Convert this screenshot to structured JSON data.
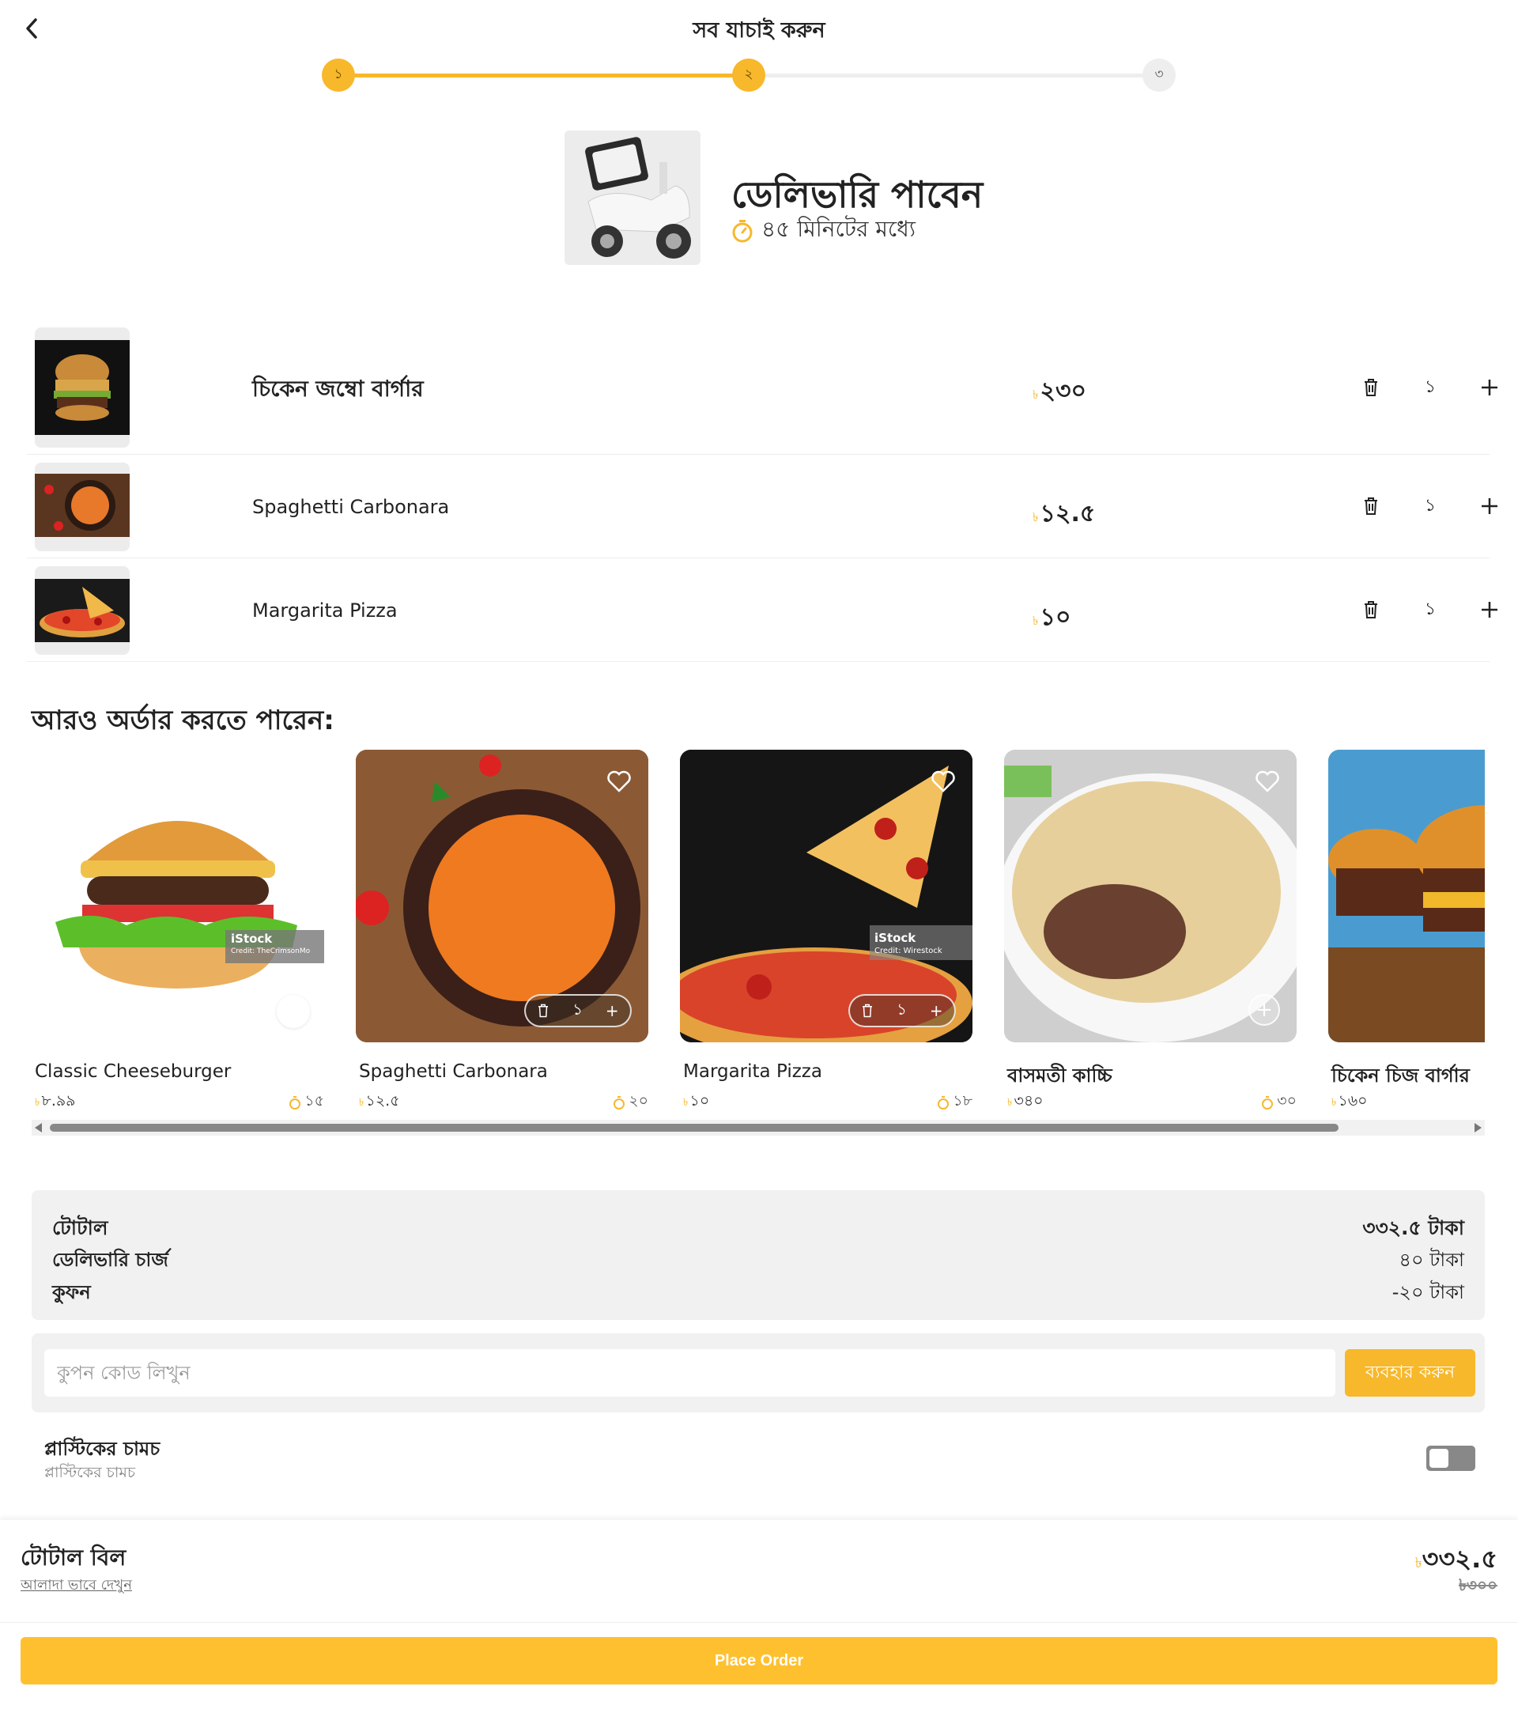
{
  "header": {
    "title": "সব যাচাই করুন"
  },
  "stepper": {
    "steps": [
      "১",
      "২",
      "৩"
    ],
    "current_step": 2
  },
  "delivery": {
    "title": "ডেলিভারি পাবেন",
    "time": "৪৫ মিনিটের মধ্যে"
  },
  "cart": {
    "items": [
      {
        "name": "চিকেন জম্বো বার্গার",
        "currency": "৳",
        "price": "২৩০",
        "qty": "১"
      },
      {
        "name": "Spaghetti Carbonara",
        "currency": "৳",
        "price": "১২.৫",
        "qty": "১"
      },
      {
        "name": "Margarita Pizza",
        "currency": "৳",
        "price": "১০",
        "qty": "১"
      }
    ]
  },
  "suggestions": {
    "title": "আরও অর্ডার করতে পারেন:",
    "items": [
      {
        "name": "Classic Cheeseburger",
        "currency": "৳",
        "price": "৮.৯৯",
        "time": "১৫",
        "watermark": "iStock",
        "watermark_credit": "Credit: TheCrimsonMo"
      },
      {
        "name": "Spaghetti Carbonara",
        "currency": "৳",
        "price": "১২.৫",
        "time": "২০",
        "qty": "১"
      },
      {
        "name": "Margarita Pizza",
        "currency": "৳",
        "price": "১০",
        "time": "১৮",
        "qty": "১",
        "watermark": "iStock",
        "watermark_credit": "Credit: Wirestock"
      },
      {
        "name": "বাসমতী কাচ্চি",
        "currency": "৳",
        "price": "৩৪০",
        "time": "৩০"
      },
      {
        "name": "চিকেন চিজ বার্গার",
        "currency": "৳",
        "price": "১৬০",
        "time": ""
      }
    ]
  },
  "summary": {
    "total_label": "টোটাল",
    "total_value": "৩৩২.৫ টাকা",
    "delivery_label": "ডেলিভারি চার্জ",
    "delivery_value": "৪০ টাকা",
    "coupon_label": "কুফন",
    "coupon_value": "-২০ টাকা"
  },
  "coupon": {
    "placeholder": "কুপন কোড লিখুন",
    "apply_label": "ব্যবহার করুন"
  },
  "spoon": {
    "title": "প্লাস্টিকের চামচ",
    "subtitle": "প্লাস্টিকের চামচ",
    "enabled": false
  },
  "footer": {
    "total_label": "টোটাল বিল",
    "view_link": "আলাদা ভাবে দেখুন",
    "currency": "৳",
    "total": "৩৩২.৫",
    "old_total": "৳৩০০",
    "order_button": "Place Order"
  },
  "colors": {
    "accent": "#F7B82B",
    "surface": "#F1F1F1"
  }
}
